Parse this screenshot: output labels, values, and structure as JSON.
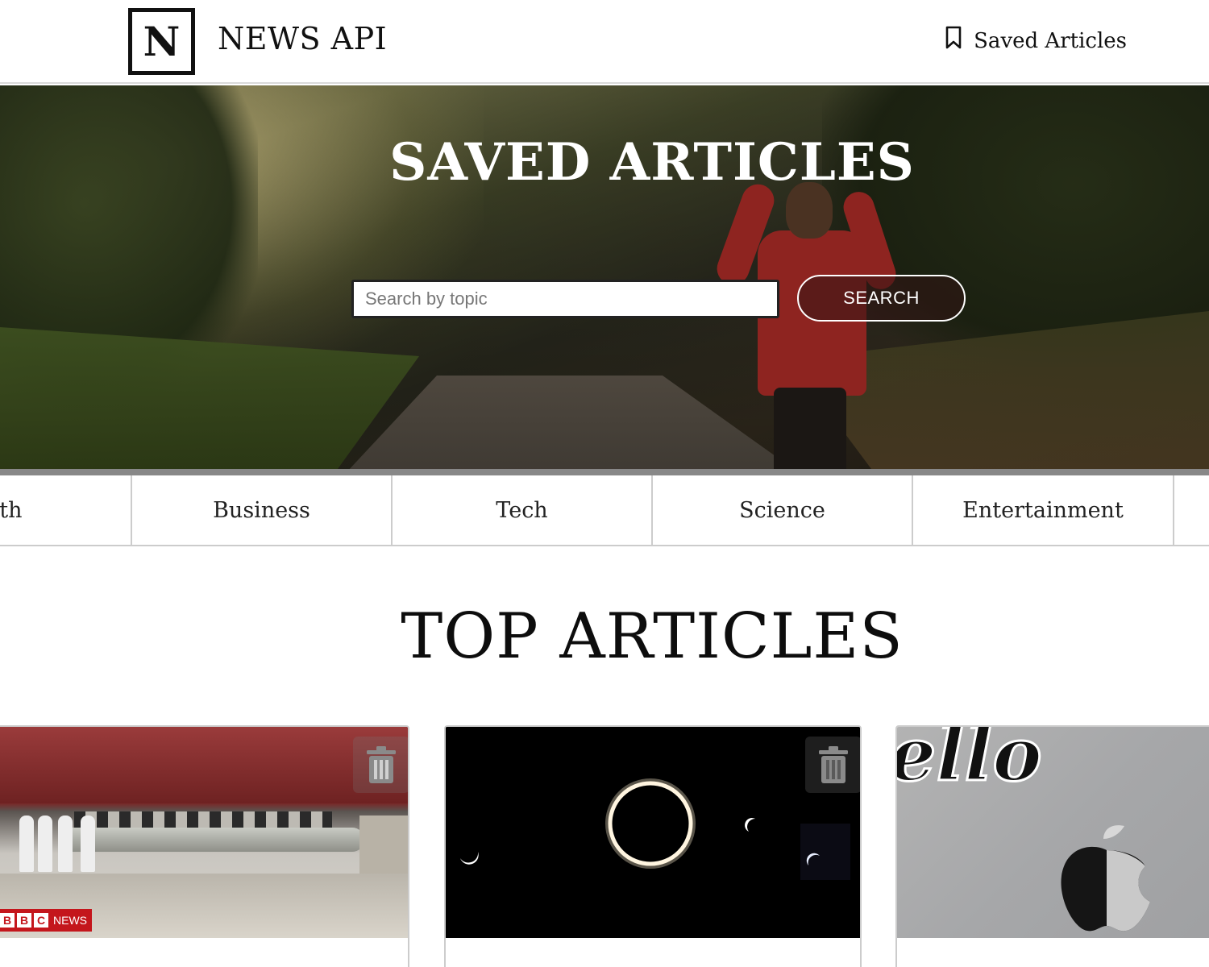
{
  "header": {
    "logo_letter": "N",
    "brand": "NEWS API",
    "saved_link": "Saved Articles"
  },
  "hero": {
    "title": "SAVED ARTICLES",
    "search_placeholder": "Search by topic",
    "search_button": "SEARCH"
  },
  "categories": [
    "alth",
    "Business",
    "Tech",
    "Science",
    "Entertainment"
  ],
  "section_title": "TOP ARTICLES",
  "cards": [
    {
      "source_badge_letters": [
        "B",
        "B",
        "C"
      ],
      "source_badge_word": "NEWS",
      "icon": "trash-icon"
    },
    {
      "icon": "trash-icon"
    },
    {
      "image_text": "ello"
    }
  ],
  "colors": {
    "search_button_border": "#ffffff",
    "bbc_red": "#c4161c",
    "divider": "#cccccc"
  }
}
